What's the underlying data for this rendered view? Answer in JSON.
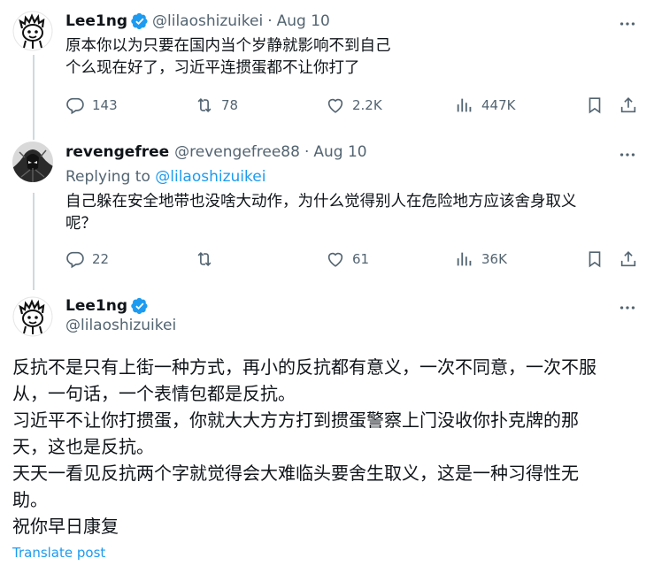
{
  "tweet1": {
    "name": "Lee1ng",
    "handle": "@lilaoshizuikei",
    "date": "Aug 10",
    "text": "原本你以为只要在国内当个岁静就影响不到自己\n个么现在好了，习近平连掼蛋都不让你打了",
    "replies": "143",
    "retweets": "78",
    "likes": "2.2K",
    "views": "447K"
  },
  "tweet2": {
    "name": "revengefree",
    "handle": "@revengefree88",
    "date": "Aug 10",
    "replying_prefix": "Replying to",
    "replying_handle": "@lilaoshizuikei",
    "text": "自己躲在安全地带也没啥大动作，为什么觉得别人在危险地方应该舍身取义\n呢？",
    "replies": "22",
    "retweets": "",
    "likes": "61",
    "views": "36K"
  },
  "main": {
    "name": "Lee1ng",
    "handle": "@lilaoshizuikei",
    "lines": [
      "反抗不是只有上街一种方式，再小的反抗都有意义，一次不同意，一次不服",
      "从，一句话，一个表情包都是反抗。",
      "习近平不让你打掼蛋，你就大大方方打到掼蛋警察上门没收你扑克牌的那",
      "天，这也是反抗。",
      "天天一看见反抗两个字就觉得会大难临头要舍生取义，这是一种习得性无",
      "助。",
      "祝你早日康复"
    ],
    "translate": "Translate post"
  },
  "colors": {
    "text": "#0f1419",
    "muted": "#536471",
    "accent": "#1d9bf0",
    "thread_line": "#cfd9de"
  },
  "icons": [
    "more-icon",
    "verified-badge-icon",
    "reply-icon",
    "retweet-icon",
    "like-icon",
    "views-icon",
    "bookmark-icon",
    "share-icon"
  ]
}
